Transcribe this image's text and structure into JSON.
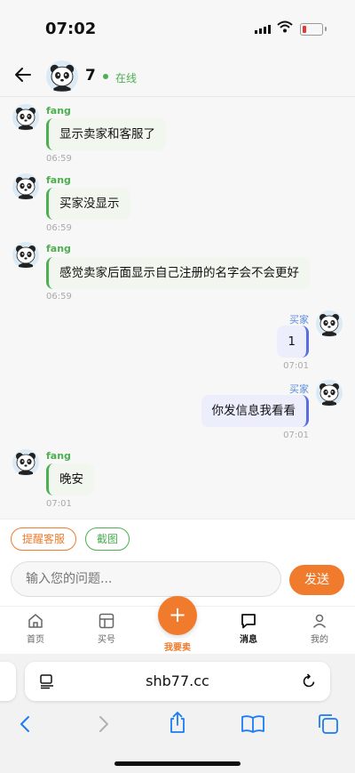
{
  "status": {
    "time": "07:02"
  },
  "header": {
    "name": "7",
    "status": "在线"
  },
  "messages": [
    {
      "side": "left",
      "sender": "fang",
      "text": "显示卖家和客服了",
      "time": "06:59"
    },
    {
      "side": "left",
      "sender": "fang",
      "text": "买家没显示",
      "time": "06:59"
    },
    {
      "side": "left",
      "sender": "fang",
      "text": "感觉卖家后面显示自己注册的名字会不会更好",
      "time": "06:59"
    },
    {
      "side": "right",
      "sender": "买家",
      "text": "1",
      "time": "07:01"
    },
    {
      "side": "right",
      "sender": "买家",
      "text": "你发信息我看看",
      "time": "07:01"
    },
    {
      "side": "left",
      "sender": "fang",
      "text": "晚安",
      "time": "07:01"
    }
  ],
  "quick_actions": {
    "remind": "提醒客服",
    "screenshot": "截图"
  },
  "composer": {
    "placeholder": "输入您的问题...",
    "send": "发送"
  },
  "tabs": {
    "home": "首页",
    "buy": "买号",
    "sell": "我要卖",
    "messages": "消息",
    "mine": "我的"
  },
  "browser": {
    "domain": "shb77.cc"
  },
  "colors": {
    "accent": "#f07b2d",
    "green": "#4caf50",
    "blue": "#5b6ee1"
  }
}
